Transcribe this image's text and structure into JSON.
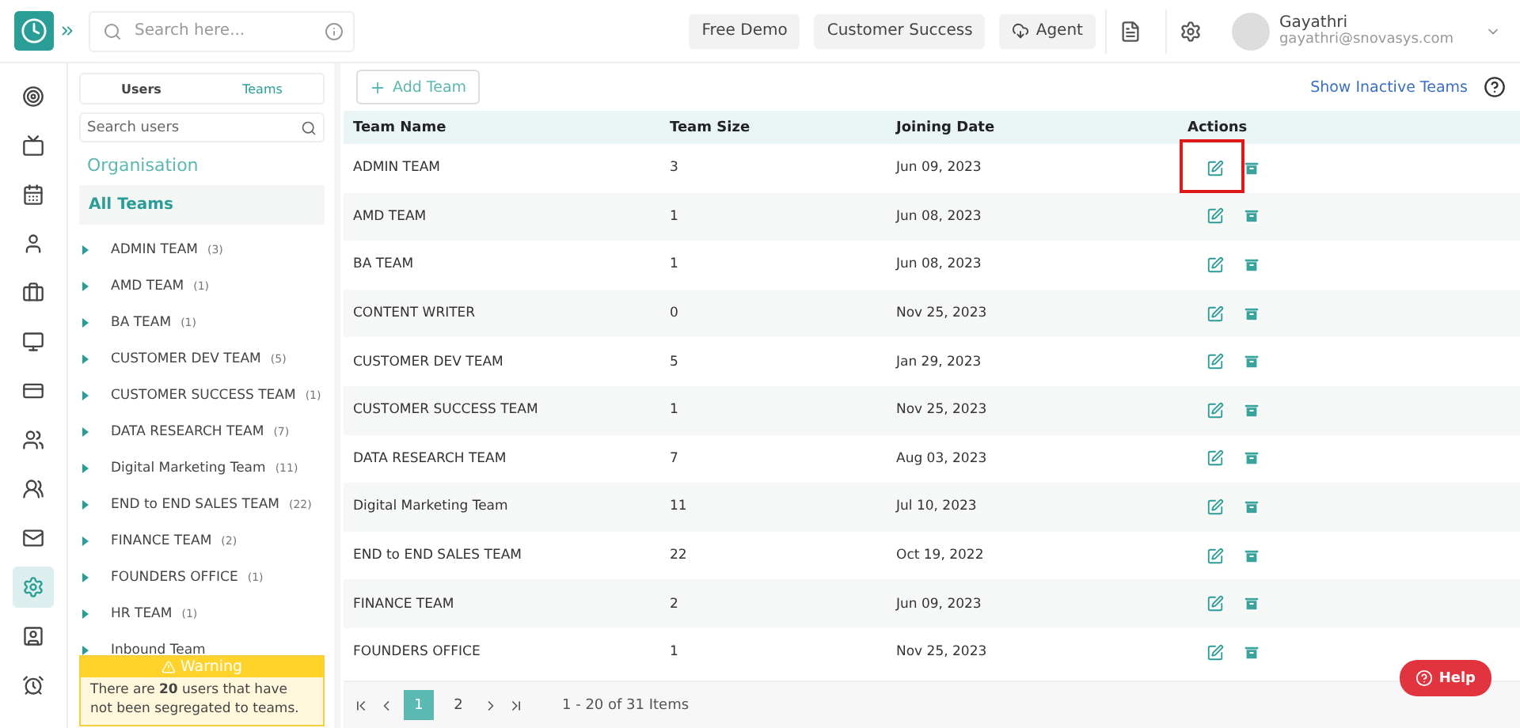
{
  "topbar": {
    "search": {
      "placeholder": "Search here..."
    },
    "buttons": [
      {
        "label": "Free Demo",
        "kind": "plain"
      },
      {
        "label": "Customer Success",
        "kind": "plain"
      },
      {
        "label": "Agent",
        "kind": "cloud"
      }
    ],
    "user": {
      "name": "Gayathri",
      "email": "gayathri@snovasys.com"
    }
  },
  "rail": [
    {
      "selected": false
    },
    {
      "selected": false
    },
    {
      "selected": false
    },
    {
      "selected": false
    },
    {
      "selected": false
    },
    {
      "selected": false
    },
    {
      "selected": false
    },
    {
      "selected": false
    },
    {
      "selected": false
    },
    {
      "selected": false
    },
    {
      "selected": true
    },
    {
      "selected": false
    },
    {
      "selected": false
    }
  ],
  "sidebar": {
    "tabs": [
      {
        "label": "Users",
        "selected": false
      },
      {
        "label": "Teams",
        "selected": true
      }
    ],
    "search": {
      "placeholder": "Search users"
    },
    "heading": "Organisation",
    "all": "All Teams",
    "items": [
      {
        "name": "ADMIN TEAM",
        "count": "(3)"
      },
      {
        "name": "AMD TEAM",
        "count": "(1)"
      },
      {
        "name": "BA TEAM",
        "count": "(1)"
      },
      {
        "name": "CUSTOMER DEV TEAM",
        "count": "(5)"
      },
      {
        "name": "CUSTOMER SUCCESS TEAM",
        "count": "(1)"
      },
      {
        "name": "DATA RESEARCH TEAM",
        "count": "(7)"
      },
      {
        "name": "Digital Marketing Team",
        "count": "(11)"
      },
      {
        "name": "END to END SALES TEAM",
        "count": "(22)"
      },
      {
        "name": "FINANCE TEAM",
        "count": "(2)"
      },
      {
        "name": "FOUNDERS OFFICE",
        "count": "(1)"
      },
      {
        "name": "HR TEAM",
        "count": "(1)"
      },
      {
        "name": "Inbound Team"
      }
    ],
    "warning": {
      "title": "Warning",
      "text": "There are **20** users that have not been segregated to teams."
    }
  },
  "toolbar": {
    "add": "Add Team",
    "link": "Show Inactive Teams"
  },
  "table": {
    "columns": [
      "Team Name",
      "Team Size",
      "Joining Date",
      "Actions"
    ],
    "rows": [
      {
        "name": "ADMIN TEAM",
        "size": "3",
        "date": "Jun 09, 2023",
        "highlighted": true
      },
      {
        "name": "AMD TEAM",
        "size": "1",
        "date": "Jun 08, 2023",
        "highlighted": false
      },
      {
        "name": "BA TEAM",
        "size": "1",
        "date": "Jun 08, 2023",
        "highlighted": false
      },
      {
        "name": "CONTENT WRITER",
        "size": "0",
        "date": "Nov 25, 2023",
        "highlighted": false
      },
      {
        "name": "CUSTOMER DEV TEAM",
        "size": "5",
        "date": "Jan 29, 2023",
        "highlighted": false
      },
      {
        "name": "CUSTOMER SUCCESS TEAM",
        "size": "1",
        "date": "Nov 25, 2023",
        "highlighted": false
      },
      {
        "name": "DATA RESEARCH TEAM",
        "size": "7",
        "date": "Aug 03, 2023",
        "highlighted": false
      },
      {
        "name": "Digital Marketing Team",
        "size": "11",
        "date": "Jul 10, 2023",
        "highlighted": false
      },
      {
        "name": "END to END SALES TEAM",
        "size": "22",
        "date": "Oct 19, 2022",
        "highlighted": false
      },
      {
        "name": "FINANCE TEAM",
        "size": "2",
        "date": "Jun 09, 2023",
        "highlighted": false
      },
      {
        "name": "FOUNDERS OFFICE",
        "size": "1",
        "date": "Nov 25, 2023",
        "highlighted": false
      }
    ]
  },
  "pager": {
    "pages": [
      {
        "label": "1",
        "selected": true
      },
      {
        "label": "2",
        "selected": false
      }
    ],
    "summary": "1 - 20 of 31 Items"
  },
  "help": "Help"
}
